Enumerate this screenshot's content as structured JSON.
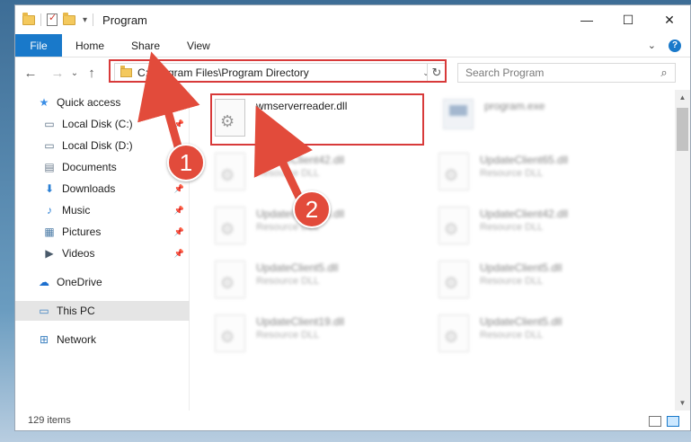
{
  "window": {
    "title": "Program",
    "minimize": "—",
    "maximize": "☐",
    "close": "✕"
  },
  "ribbon": {
    "tabs": [
      "File",
      "Home",
      "Share",
      "View"
    ],
    "expand": "⌄",
    "help": "?"
  },
  "nav": {
    "back": "←",
    "forward": "→",
    "recent": "⌄",
    "up": "↑"
  },
  "address": {
    "path": "C:\\Program Files\\Program Directory",
    "dropdown": "⌄",
    "refresh": "↻"
  },
  "search": {
    "placeholder": "Search Program",
    "icon": "⌕"
  },
  "sidebar": {
    "items": [
      {
        "label": "Quick access",
        "icon": "★"
      },
      {
        "label": "Local Disk (C:)",
        "icon": "▭"
      },
      {
        "label": "Local Disk (D:)",
        "icon": "▭"
      },
      {
        "label": "Documents",
        "icon": "▤"
      },
      {
        "label": "Downloads",
        "icon": "⬇"
      },
      {
        "label": "Music",
        "icon": "♪"
      },
      {
        "label": "Pictures",
        "icon": "▦"
      },
      {
        "label": "Videos",
        "icon": "▶"
      },
      {
        "label": "OneDrive",
        "icon": "☁"
      },
      {
        "label": "This PC",
        "icon": "▭"
      },
      {
        "label": "Network",
        "icon": "⊞"
      }
    ],
    "pin": "📌"
  },
  "files": {
    "highlighted": {
      "name": "wmserverreader.dll"
    },
    "exe": {
      "name": "program.exe"
    },
    "blurred": [
      {
        "name": "UpdateClient42.dll",
        "type": "Resource DLL"
      },
      {
        "name": "UpdateClient65.dll",
        "type": "Resource DLL"
      },
      {
        "name": "UpdateClient43.dll",
        "type": "Resource DLL"
      },
      {
        "name": "UpdateClient42.dll",
        "type": "Resource DLL"
      },
      {
        "name": "UpdateClient5.dll",
        "type": "Resource DLL"
      },
      {
        "name": "UpdateClient5.dll",
        "type": "Resource DLL"
      },
      {
        "name": "UpdateClient19.dll",
        "type": "Resource DLL"
      },
      {
        "name": "UpdateClient5.dll",
        "type": "Resource DLL"
      }
    ]
  },
  "status": {
    "count": "129 items"
  },
  "annotations": {
    "step1": "1",
    "step2": "2",
    "color": "#d83a3a"
  }
}
